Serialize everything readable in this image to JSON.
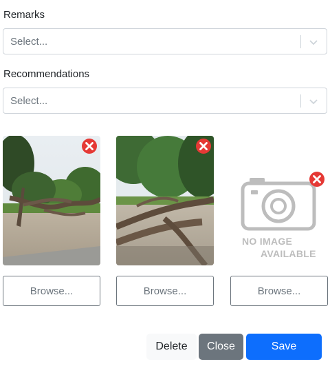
{
  "form": {
    "remarks": {
      "label": "Remarks",
      "placeholder": "Select..."
    },
    "recommendations": {
      "label": "Recommendations",
      "placeholder": "Select..."
    }
  },
  "images": {
    "slots": [
      {
        "state": "photo",
        "description": "park-tree-photo-1"
      },
      {
        "state": "photo",
        "description": "park-tree-photo-2"
      },
      {
        "state": "empty",
        "placeholder_line1": "NO IMAGE",
        "placeholder_line2": "AVAILABLE"
      }
    ],
    "browse_label": "Browse..."
  },
  "actions": {
    "delete": "Delete",
    "close": "Close",
    "save": "Save"
  },
  "colors": {
    "primary": "#0d6efd",
    "secondary": "#6c757d",
    "remove_badge": "#e53935"
  }
}
